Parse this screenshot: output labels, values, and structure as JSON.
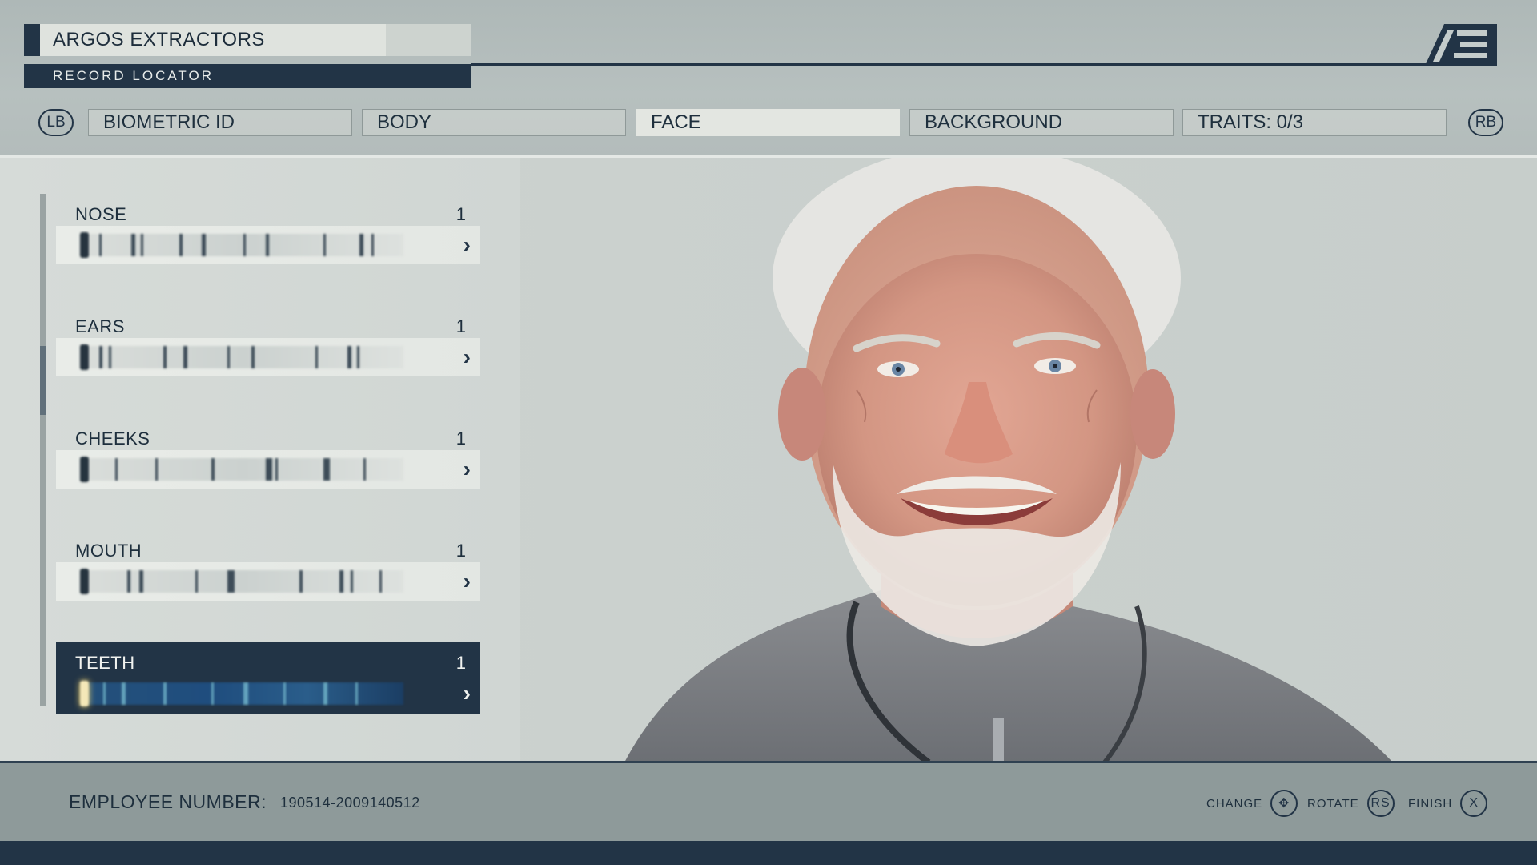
{
  "header": {
    "company_name": "ARGOS EXTRACTORS",
    "record_locator": "RECORD LOCATOR",
    "logo": "AE"
  },
  "bumpers": {
    "left": "LB",
    "right": "RB"
  },
  "tabs": [
    {
      "label": "BIOMETRIC ID",
      "active": false
    },
    {
      "label": "BODY",
      "active": false
    },
    {
      "label": "FACE",
      "active": true
    },
    {
      "label": "BACKGROUND",
      "active": false
    },
    {
      "label": "TRAITS: 0/3",
      "active": false
    }
  ],
  "face_options": [
    {
      "label": "NOSE",
      "value": "1",
      "selected": false
    },
    {
      "label": "EARS",
      "value": "1",
      "selected": false
    },
    {
      "label": "CHEEKS",
      "value": "1",
      "selected": false
    },
    {
      "label": "MOUTH",
      "value": "1",
      "selected": false
    },
    {
      "label": "TEETH",
      "value": "1",
      "selected": true
    }
  ],
  "footer": {
    "employee_number_label": "EMPLOYEE NUMBER:",
    "employee_number": "190514-2009140512",
    "hints": [
      {
        "label": "CHANGE",
        "button": "✥"
      },
      {
        "label": "ROTATE",
        "button": "RS"
      },
      {
        "label": "FINISH",
        "button": "X"
      }
    ]
  },
  "colors": {
    "navy": "#223446",
    "panel_light": "#e3e6e1",
    "selected_glow": "#f4e8b8"
  }
}
